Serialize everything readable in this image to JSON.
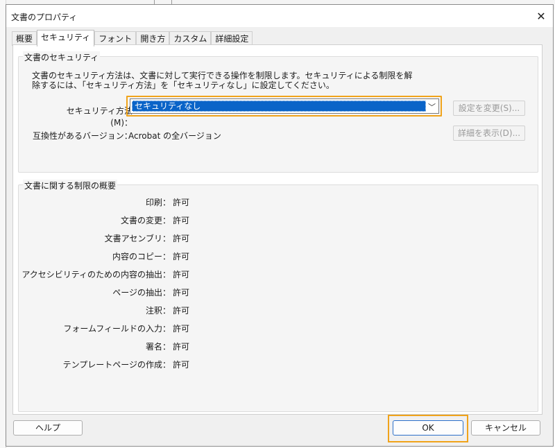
{
  "dialog": {
    "title": "文書のプロパティ",
    "close_glyph": "✕"
  },
  "tabs": [
    {
      "label": "概要",
      "active": false
    },
    {
      "label": "セキュリティ",
      "active": true
    },
    {
      "label": "フォント",
      "active": false
    },
    {
      "label": "開き方",
      "active": false
    },
    {
      "label": "カスタム",
      "active": false
    },
    {
      "label": "詳細設定",
      "active": false
    }
  ],
  "security": {
    "legend": "文書のセキュリティ",
    "description_line1": "文書のセキュリティ方法は、文書に対して実行できる操作を制限します。セキュリティによる制限を解",
    "description_line2": "除するには、「セキュリティ方法」を「セキュリティなし」に設定してください。",
    "method_label": "セキュリティ方法(M)：",
    "method_value": "セキュリティなし",
    "change_settings_button": "設定を変更(S)...",
    "compat_label": "互換性があるバージョン：",
    "compat_value": "Acrobat の全バージョン",
    "show_details_button": "詳細を表示(D)..."
  },
  "restrictions": {
    "legend": "文書に関する制限の概要",
    "items": [
      {
        "label": "印刷：",
        "value": "許可"
      },
      {
        "label": "文書の変更：",
        "value": "許可"
      },
      {
        "label": "文書アセンブリ：",
        "value": "許可"
      },
      {
        "label": "内容のコピー：",
        "value": "許可"
      },
      {
        "label": "アクセシビリティのための内容の抽出：",
        "value": "許可"
      },
      {
        "label": "ページの抽出：",
        "value": "許可"
      },
      {
        "label": "注釈：",
        "value": "許可"
      },
      {
        "label": "フォームフィールドの入力：",
        "value": "許可"
      },
      {
        "label": "署名：",
        "value": "許可"
      },
      {
        "label": "テンプレートページの作成：",
        "value": "許可"
      }
    ]
  },
  "footer": {
    "help": "ヘルプ",
    "ok": "OK",
    "cancel": "キャンセル"
  },
  "colors": {
    "highlight": "#f0a31a",
    "selection": "#0a64c8"
  },
  "icons": {
    "close": "close-icon",
    "dropdown": "chevron-down-icon"
  }
}
